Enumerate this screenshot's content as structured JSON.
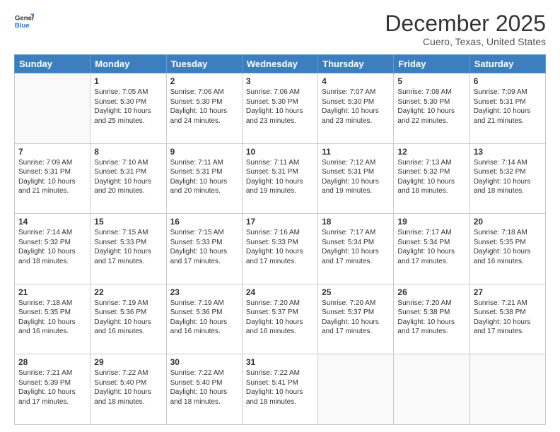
{
  "logo": {
    "line1": "General",
    "line2": "Blue"
  },
  "title": "December 2025",
  "location": "Cuero, Texas, United States",
  "days_header": [
    "Sunday",
    "Monday",
    "Tuesday",
    "Wednesday",
    "Thursday",
    "Friday",
    "Saturday"
  ],
  "weeks": [
    [
      {
        "num": "",
        "info": ""
      },
      {
        "num": "1",
        "info": "Sunrise: 7:05 AM\nSunset: 5:30 PM\nDaylight: 10 hours\nand 25 minutes."
      },
      {
        "num": "2",
        "info": "Sunrise: 7:06 AM\nSunset: 5:30 PM\nDaylight: 10 hours\nand 24 minutes."
      },
      {
        "num": "3",
        "info": "Sunrise: 7:06 AM\nSunset: 5:30 PM\nDaylight: 10 hours\nand 23 minutes."
      },
      {
        "num": "4",
        "info": "Sunrise: 7:07 AM\nSunset: 5:30 PM\nDaylight: 10 hours\nand 23 minutes."
      },
      {
        "num": "5",
        "info": "Sunrise: 7:08 AM\nSunset: 5:30 PM\nDaylight: 10 hours\nand 22 minutes."
      },
      {
        "num": "6",
        "info": "Sunrise: 7:09 AM\nSunset: 5:31 PM\nDaylight: 10 hours\nand 21 minutes."
      }
    ],
    [
      {
        "num": "7",
        "info": "Sunrise: 7:09 AM\nSunset: 5:31 PM\nDaylight: 10 hours\nand 21 minutes."
      },
      {
        "num": "8",
        "info": "Sunrise: 7:10 AM\nSunset: 5:31 PM\nDaylight: 10 hours\nand 20 minutes."
      },
      {
        "num": "9",
        "info": "Sunrise: 7:11 AM\nSunset: 5:31 PM\nDaylight: 10 hours\nand 20 minutes."
      },
      {
        "num": "10",
        "info": "Sunrise: 7:11 AM\nSunset: 5:31 PM\nDaylight: 10 hours\nand 19 minutes."
      },
      {
        "num": "11",
        "info": "Sunrise: 7:12 AM\nSunset: 5:31 PM\nDaylight: 10 hours\nand 19 minutes."
      },
      {
        "num": "12",
        "info": "Sunrise: 7:13 AM\nSunset: 5:32 PM\nDaylight: 10 hours\nand 18 minutes."
      },
      {
        "num": "13",
        "info": "Sunrise: 7:14 AM\nSunset: 5:32 PM\nDaylight: 10 hours\nand 18 minutes."
      }
    ],
    [
      {
        "num": "14",
        "info": "Sunrise: 7:14 AM\nSunset: 5:32 PM\nDaylight: 10 hours\nand 18 minutes."
      },
      {
        "num": "15",
        "info": "Sunrise: 7:15 AM\nSunset: 5:33 PM\nDaylight: 10 hours\nand 17 minutes."
      },
      {
        "num": "16",
        "info": "Sunrise: 7:15 AM\nSunset: 5:33 PM\nDaylight: 10 hours\nand 17 minutes."
      },
      {
        "num": "17",
        "info": "Sunrise: 7:16 AM\nSunset: 5:33 PM\nDaylight: 10 hours\nand 17 minutes."
      },
      {
        "num": "18",
        "info": "Sunrise: 7:17 AM\nSunset: 5:34 PM\nDaylight: 10 hours\nand 17 minutes."
      },
      {
        "num": "19",
        "info": "Sunrise: 7:17 AM\nSunset: 5:34 PM\nDaylight: 10 hours\nand 17 minutes."
      },
      {
        "num": "20",
        "info": "Sunrise: 7:18 AM\nSunset: 5:35 PM\nDaylight: 10 hours\nand 16 minutes."
      }
    ],
    [
      {
        "num": "21",
        "info": "Sunrise: 7:18 AM\nSunset: 5:35 PM\nDaylight: 10 hours\nand 16 minutes."
      },
      {
        "num": "22",
        "info": "Sunrise: 7:19 AM\nSunset: 5:36 PM\nDaylight: 10 hours\nand 16 minutes."
      },
      {
        "num": "23",
        "info": "Sunrise: 7:19 AM\nSunset: 5:36 PM\nDaylight: 10 hours\nand 16 minutes."
      },
      {
        "num": "24",
        "info": "Sunrise: 7:20 AM\nSunset: 5:37 PM\nDaylight: 10 hours\nand 16 minutes."
      },
      {
        "num": "25",
        "info": "Sunrise: 7:20 AM\nSunset: 5:37 PM\nDaylight: 10 hours\nand 17 minutes."
      },
      {
        "num": "26",
        "info": "Sunrise: 7:20 AM\nSunset: 5:38 PM\nDaylight: 10 hours\nand 17 minutes."
      },
      {
        "num": "27",
        "info": "Sunrise: 7:21 AM\nSunset: 5:38 PM\nDaylight: 10 hours\nand 17 minutes."
      }
    ],
    [
      {
        "num": "28",
        "info": "Sunrise: 7:21 AM\nSunset: 5:39 PM\nDaylight: 10 hours\nand 17 minutes."
      },
      {
        "num": "29",
        "info": "Sunrise: 7:22 AM\nSunset: 5:40 PM\nDaylight: 10 hours\nand 18 minutes."
      },
      {
        "num": "30",
        "info": "Sunrise: 7:22 AM\nSunset: 5:40 PM\nDaylight: 10 hours\nand 18 minutes."
      },
      {
        "num": "31",
        "info": "Sunrise: 7:22 AM\nSunset: 5:41 PM\nDaylight: 10 hours\nand 18 minutes."
      },
      {
        "num": "",
        "info": ""
      },
      {
        "num": "",
        "info": ""
      },
      {
        "num": "",
        "info": ""
      }
    ]
  ]
}
